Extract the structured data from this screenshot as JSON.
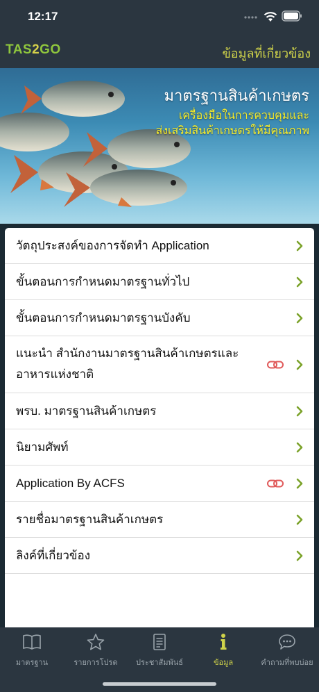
{
  "status_bar": {
    "time": "12:17"
  },
  "header": {
    "logo_part1": "TAS",
    "logo_part2": "2",
    "logo_part3": "GO",
    "title": "ข้อมูลที่เกี่ยวข้อง"
  },
  "banner": {
    "title": "มาตรฐานสินค้าเกษตร",
    "subtitle_line1": "เครื่องมือในการควบคุมและ",
    "subtitle_line2": "ส่งเสริมสินค้าเกษตรให้มีคุณภาพ"
  },
  "menu": {
    "items": [
      {
        "label": "วัตถุประสงค์ของการจัดทำ Application",
        "has_link_icon": false
      },
      {
        "label": "ขั้นตอนการกำหนดมาตรฐานทั่วไป",
        "has_link_icon": false
      },
      {
        "label": "ขั้นตอนการกำหนดมาตรฐานบังคับ",
        "has_link_icon": false
      },
      {
        "label_line1": "แนะนำ สำนักงานมาตรฐานสินค้าเกษตรและ",
        "label_line2": "อาหารแห่งชาติ",
        "has_link_icon": true
      },
      {
        "label": "พรบ. มาตรฐานสินค้าเกษตร",
        "has_link_icon": false
      },
      {
        "label": "นิยามศัพท์",
        "has_link_icon": false
      },
      {
        "label": "Application By ACFS",
        "has_link_icon": true
      },
      {
        "label": "รายชื่อมาตรฐานสินค้าเกษตร",
        "has_link_icon": false
      },
      {
        "label": "ลิงค์ที่เกี่ยวข้อง",
        "has_link_icon": false
      }
    ]
  },
  "tab_bar": {
    "tabs": [
      {
        "label": "มาตรฐาน",
        "icon": "book-icon",
        "active": false
      },
      {
        "label": "รายการโปรด",
        "icon": "star-icon",
        "active": false
      },
      {
        "label": "ประชาสัมพันธ์",
        "icon": "document-icon",
        "active": false
      },
      {
        "label": "ข้อมูล",
        "icon": "info-icon",
        "active": true
      },
      {
        "label": "คำถามที่พบบ่อย",
        "icon": "chat-icon",
        "active": false
      }
    ]
  },
  "colors": {
    "header_bg": "#2b3640",
    "accent_yellow_green": "#cfd34a",
    "chevron_green": "#7ba22a",
    "link_icon_red": "#e05a5a"
  }
}
